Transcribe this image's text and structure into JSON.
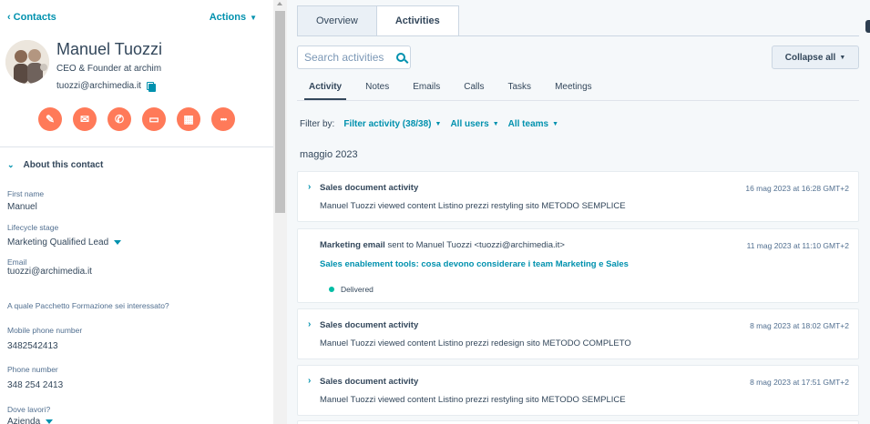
{
  "header": {
    "back_label": "Contacts",
    "actions_label": "Actions"
  },
  "contact": {
    "name": "Manuel Tuozzi",
    "title": "CEO & Founder at archim",
    "email": "tuozzi@archimedia.it"
  },
  "action_buttons": [
    {
      "icon": "pencil-icon",
      "glyph": "✎"
    },
    {
      "icon": "mail-icon",
      "glyph": "✉"
    },
    {
      "icon": "phone-icon",
      "glyph": "✆"
    },
    {
      "icon": "task-icon",
      "glyph": "▭"
    },
    {
      "icon": "calendar-icon",
      "glyph": "▦"
    },
    {
      "icon": "more-icon",
      "glyph": "•••"
    }
  ],
  "about": {
    "heading": "About this contact",
    "first_name_label": "First name",
    "first_name": "Manuel",
    "lifecycle_label": "Lifecycle stage",
    "lifecycle": "Marketing Qualified Lead",
    "email_label": "Email",
    "email": "tuozzi@archimedia.it",
    "pacchetto_label": "A quale Pacchetto Formazione sei interessato?",
    "mobile_label": "Mobile phone number",
    "mobile": "3482542413",
    "phone_label": "Phone number",
    "phone": "348 254 2413",
    "dove_label": "Dove lavori?",
    "dove": "Azienda"
  },
  "tabs": {
    "overview": "Overview",
    "activities": "Activities"
  },
  "search": {
    "placeholder": "Search activities"
  },
  "collapse_label": "Collapse all",
  "subtabs": [
    "Activity",
    "Notes",
    "Emails",
    "Calls",
    "Tasks",
    "Meetings"
  ],
  "filter": {
    "label": "Filter by:",
    "activity": "Filter activity (38/38)",
    "users": "All users",
    "teams": "All teams"
  },
  "month": "maggio 2023",
  "activities": [
    {
      "title": "Sales document activity",
      "time": "16 mag 2023 at 16:28 GMT+2",
      "desc": "Manuel Tuozzi viewed content Listino prezzi restyling sito METODO SEMPLICE"
    },
    {
      "title": "Marketing email",
      "title_rest": "sent to Manuel Tuozzi <tuozzi@archimedia.it>",
      "time": "11 mag 2023 at 11:10 GMT+2",
      "link": "Sales enablement tools: cosa devono considerare i team Marketing e Sales",
      "status": "Delivered"
    },
    {
      "title": "Sales document activity",
      "time": "8 mag 2023 at 18:02 GMT+2",
      "desc": "Manuel Tuozzi viewed content Listino prezzi redesign sito METODO COMPLETO"
    },
    {
      "title": "Sales document activity",
      "time": "8 mag 2023 at 17:51 GMT+2",
      "desc": "Manuel Tuozzi viewed content Listino prezzi restyling sito METODO SEMPLICE"
    }
  ],
  "colors": {
    "accent": "#0091ae",
    "action": "#ff7a59",
    "text": "#33475b",
    "delivered": "#00bda5"
  }
}
